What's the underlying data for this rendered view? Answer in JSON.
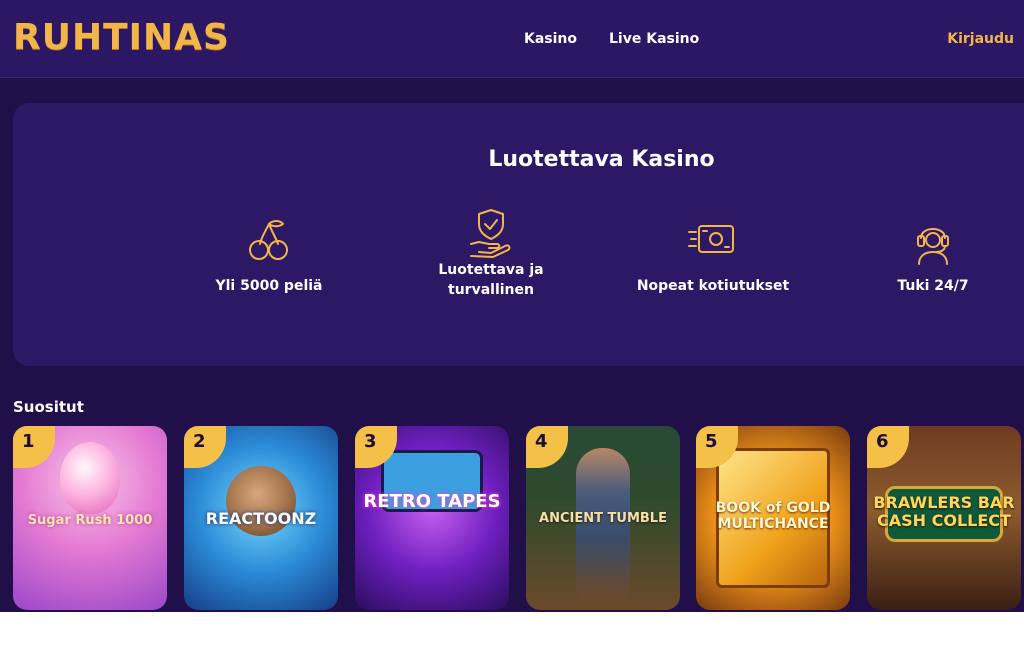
{
  "brand": {
    "logo_text": "RUHTINAS",
    "accent_color": "#f2b54a",
    "header_bg": "#2b1763",
    "page_bg": "#210f4a",
    "hero_bg": "#2d1866"
  },
  "header": {
    "nav": [
      {
        "label": "Kasino"
      },
      {
        "label": "Live Kasino"
      }
    ],
    "login_label": "Kirjaudu"
  },
  "hero": {
    "title": "Luotettava Kasino",
    "features": [
      {
        "icon": "cherries-icon",
        "label": "Yli 5000 peliä"
      },
      {
        "icon": "shield-hand-icon",
        "label": "Luotettava ja turvallinen"
      },
      {
        "icon": "banknote-speed-icon",
        "label": "Nopeat kotiutukset"
      },
      {
        "icon": "headset-support-icon",
        "label": "Tuki 24/7"
      }
    ]
  },
  "popular": {
    "title": "Suositut",
    "games": [
      {
        "rank": "1",
        "name": "Sugar Rush 1000"
      },
      {
        "rank": "2",
        "name": "REACTOONZ"
      },
      {
        "rank": "3",
        "name": "RETRO TAPES"
      },
      {
        "rank": "4",
        "name": "ANCIENT TUMBLE"
      },
      {
        "rank": "5",
        "name": "BOOK of GOLD MULTICHANCE"
      },
      {
        "rank": "6",
        "name": "BRAWLERS BAR CASH COLLECT"
      }
    ]
  }
}
